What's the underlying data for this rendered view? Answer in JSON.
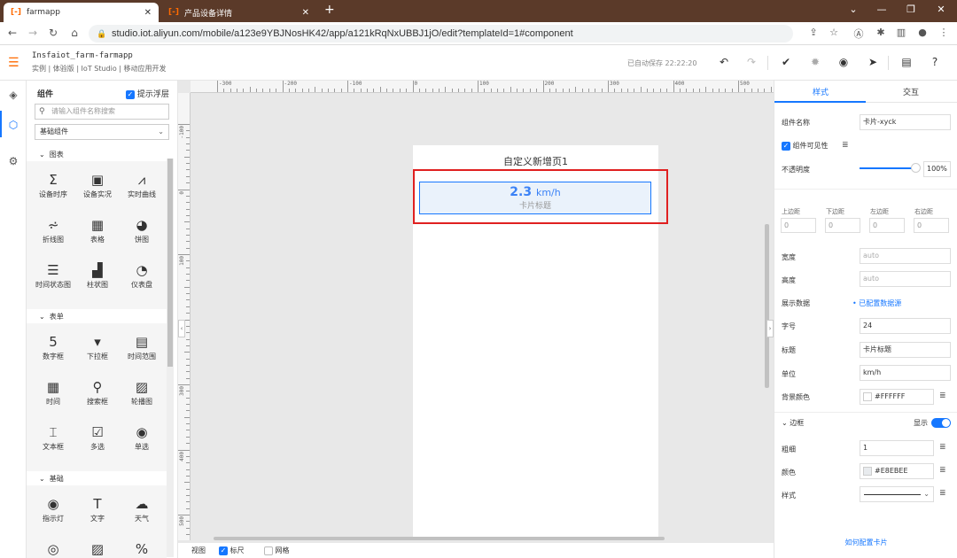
{
  "browser": {
    "tabs": [
      {
        "title": "farmapp",
        "close": "✕"
      },
      {
        "title": "产品设备详情",
        "close": "✕"
      }
    ],
    "new_tab": "+",
    "url": "studio.iot.aliyun.com/mobile/a123e9YBJNosHK42/app/a121kRqNxUBBJ1jO/edit?templateId=1#component",
    "window_controls": [
      "⌄",
      "—",
      "❐",
      "✕"
    ]
  },
  "header": {
    "title": "Insfaiot_farm-farmapp",
    "subtitle": "实例 | 体验版 | IoT Studio | 移动应用开发",
    "autosave": "已自动保存 22:22:20"
  },
  "components": {
    "title": "组件",
    "float_label": "提示浮层",
    "search_placeholder": "请输入组件名称搜索",
    "category": "基础组件",
    "sections": [
      {
        "name": "图表",
        "items": [
          {
            "label": "设备时序",
            "icon": "Σ"
          },
          {
            "label": "设备实况",
            "icon": "▣"
          },
          {
            "label": "实时曲线",
            "icon": "⩘"
          },
          {
            "label": "折线图",
            "icon": "⩫"
          },
          {
            "label": "表格",
            "icon": "▦"
          },
          {
            "label": "饼图",
            "icon": "◕"
          },
          {
            "label": "时间状态图",
            "icon": "☰"
          },
          {
            "label": "柱状图",
            "icon": "▟"
          },
          {
            "label": "仪表盘",
            "icon": "◔"
          }
        ]
      },
      {
        "name": "表单",
        "items": [
          {
            "label": "数字框",
            "icon": "5"
          },
          {
            "label": "下拉框",
            "icon": "▾"
          },
          {
            "label": "时间范围",
            "icon": "▤"
          },
          {
            "label": "时间",
            "icon": "▦"
          },
          {
            "label": "搜索框",
            "icon": "⚲"
          },
          {
            "label": "轮播图",
            "icon": "▨"
          },
          {
            "label": "文本框",
            "icon": "⌶"
          },
          {
            "label": "多选",
            "icon": "☑"
          },
          {
            "label": "单选",
            "icon": "◉"
          }
        ]
      },
      {
        "name": "基础",
        "items": [
          {
            "label": "指示灯",
            "icon": "◉"
          },
          {
            "label": "文字",
            "icon": "T"
          },
          {
            "label": "天气",
            "icon": "☁"
          },
          {
            "label": "",
            "icon": "◎"
          },
          {
            "label": "",
            "icon": "▨"
          },
          {
            "label": "",
            "icon": "%"
          }
        ]
      }
    ]
  },
  "canvas": {
    "hruler_labels": [
      "-300",
      "-200",
      "-100",
      "0",
      "100",
      "200",
      "300",
      "400",
      "500"
    ],
    "vruler_labels": [
      "-100",
      "0",
      "100",
      "200",
      "300",
      "400",
      "500"
    ],
    "page_title": "自定义新增页1",
    "card": {
      "value": "2.3",
      "unit": "km/h",
      "title": "卡片标题"
    },
    "footer": {
      "view": "视图",
      "ruler": "标尺",
      "grid": "网格"
    }
  },
  "props": {
    "tabs": [
      "样式",
      "交互"
    ],
    "name_label": "组件名称",
    "name_value": "卡片-xyck",
    "visible_label": "组件可见性",
    "opacity_label": "不透明度",
    "opacity_value": "100%",
    "opacity_level": 1.0,
    "margin_labels": [
      "上边距",
      "下边距",
      "左边距",
      "右边距"
    ],
    "margin_values": [
      "0",
      "0",
      "0",
      "0"
    ],
    "width_label": "宽度",
    "width_value": "auto",
    "height_label": "高度",
    "height_value": "auto",
    "data_label": "展示数据",
    "data_value": "已配置数据源",
    "fontsize_label": "字号",
    "fontsize_value": "24",
    "title_label": "标题",
    "title_value": "卡片标题",
    "unit_label": "单位",
    "unit_value": "km/h",
    "bg_label": "背景颜色",
    "bg_value": "#FFFFFF",
    "border_section": "边框",
    "border_show": "显示",
    "thickness_label": "粗细",
    "thickness_value": "1",
    "color_label": "颜色",
    "color_value": "#E8EBEE",
    "style_label": "样式",
    "help_link": "如何配置卡片"
  },
  "colors": {
    "accent": "#1677ff",
    "brand": "#ff6a00",
    "highlight": "#e02020"
  }
}
